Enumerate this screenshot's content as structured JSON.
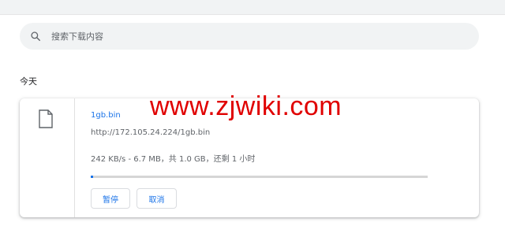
{
  "search": {
    "placeholder": "搜索下载内容",
    "value": ""
  },
  "section": {
    "label": "今天"
  },
  "download": {
    "filename": "1gb.bin",
    "url": "http://172.105.24.224/1gb.bin",
    "status": "242 KB/s - 6.7 MB，共 1.0 GB，还剩 1 小时",
    "progress_percent": 0.65,
    "pause_label": "暂停",
    "cancel_label": "取消"
  },
  "watermark": {
    "text": "www.zjwiki.com"
  },
  "icons": {
    "search": "search-icon",
    "file": "file-icon"
  },
  "colors": {
    "accent": "#1a73e8",
    "watermark": "#e00000",
    "search_bg": "#f1f3f4",
    "progress_track": "#d6d6d6"
  }
}
